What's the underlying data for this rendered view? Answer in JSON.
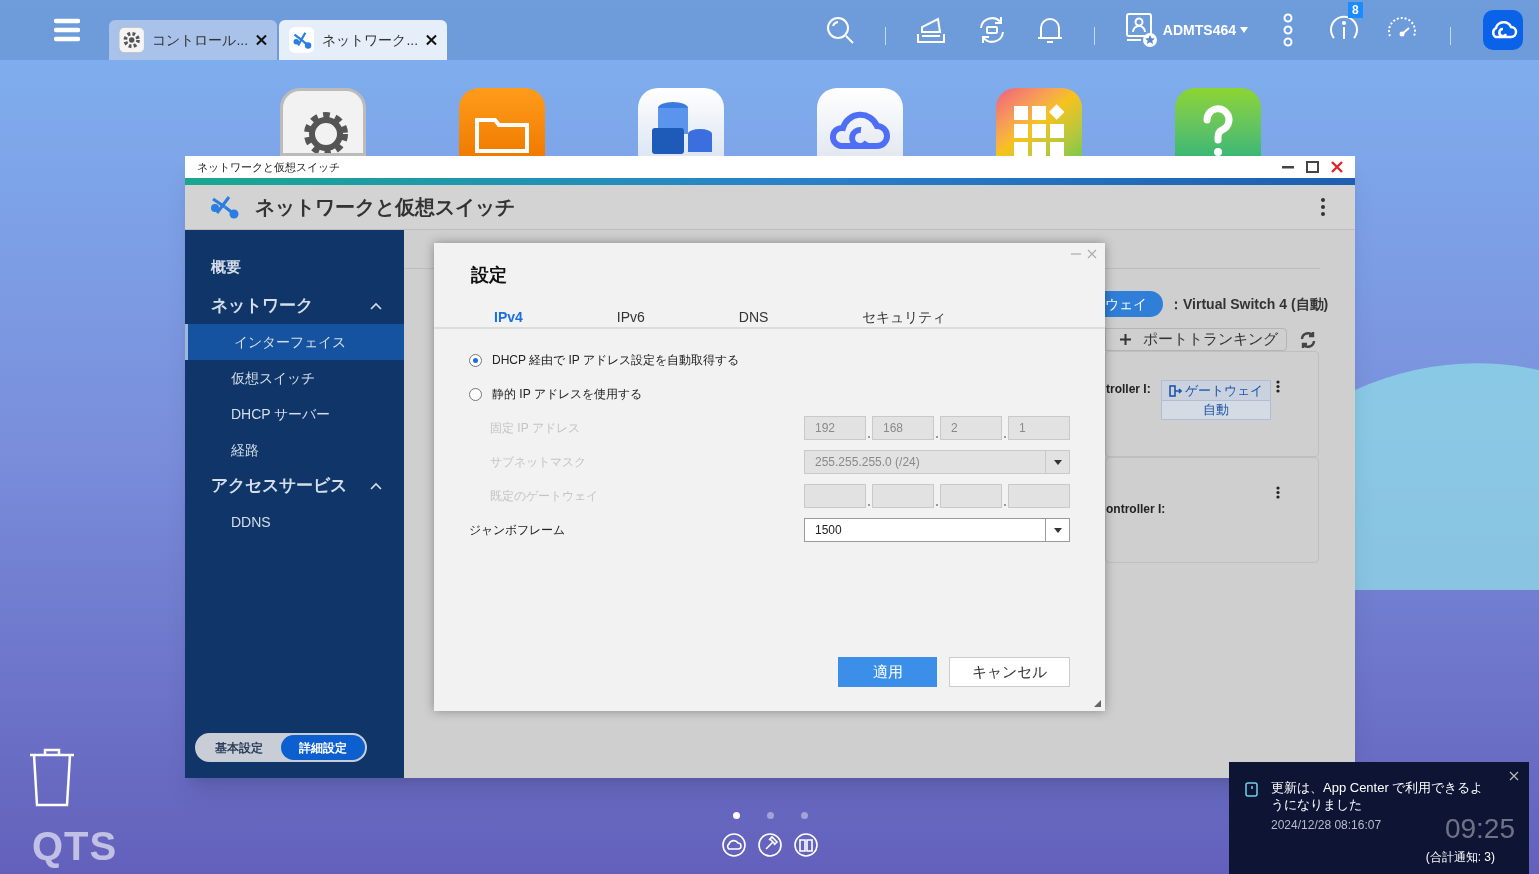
{
  "taskbar": {
    "tabs": [
      {
        "label": "コントロール...",
        "selected": false,
        "kind": "gear"
      },
      {
        "label": "ネットワーク...",
        "selected": true,
        "kind": "network"
      }
    ],
    "username": "ADMTS464",
    "info_badge": "8"
  },
  "window": {
    "title": "ネットワークと仮想スイッチ",
    "app_title": "ネットワークと仮想スイッチ"
  },
  "sidebar": {
    "items": [
      {
        "label": "概要",
        "kind": "top"
      },
      {
        "label": "ネットワーク",
        "kind": "group",
        "expanded": true,
        "children": [
          {
            "label": "インターフェイス",
            "selected": true
          },
          {
            "label": "仮想スイッチ",
            "selected": false
          },
          {
            "label": "DHCP サーバー",
            "selected": false
          },
          {
            "label": "経路",
            "selected": false
          }
        ]
      },
      {
        "label": "アクセスサービス",
        "kind": "group",
        "expanded": true,
        "children": [
          {
            "label": "DDNS",
            "selected": false
          }
        ]
      }
    ],
    "mode_toggle": [
      {
        "label": "基本設定",
        "selected": false
      },
      {
        "label": "詳細設定",
        "selected": true
      }
    ]
  },
  "background_panel": {
    "gateway_pill": "ウェイ",
    "gateway_value": "：Virtual Switch 4 (自動)",
    "port_trunking": "ポートトランキング",
    "cards": [
      {
        "label": "troller I:",
        "gateway": "ゲートウェイ",
        "gateway_mode": "自動"
      },
      {
        "label": "ontroller I:"
      }
    ]
  },
  "dialog": {
    "title": "設定",
    "tabs": [
      {
        "label": "IPv4",
        "selected": true
      },
      {
        "label": "IPv6",
        "selected": false
      },
      {
        "label": "DNS",
        "selected": false
      },
      {
        "label": "セキュリティ",
        "selected": false
      }
    ],
    "options": [
      {
        "label": "DHCP 経由で IP アドレス設定を自動取得する",
        "selected": true
      },
      {
        "label": "静的 IP アドレスを使用する",
        "selected": false
      }
    ],
    "fields": [
      {
        "label": "固定 IP アドレス",
        "kind": "ip",
        "disabled": true,
        "values": [
          "192",
          "168",
          "2",
          "1"
        ]
      },
      {
        "label": "サブネットマスク",
        "kind": "select",
        "disabled": true,
        "value": "255.255.255.0 (/24)"
      },
      {
        "label": "既定のゲートウェイ",
        "kind": "ip",
        "disabled": true
      },
      {
        "label": "ジャンボフレーム",
        "kind": "select",
        "disabled": false,
        "value": "1500"
      }
    ],
    "buttons": [
      {
        "label": "適用",
        "kind": "primary"
      },
      {
        "label": "キャンセル",
        "kind": "secondary"
      }
    ]
  },
  "notification": {
    "message": "更新は、App Center で利用できるようになりました",
    "time": "2024/12/28 08:16:07",
    "total": "(合計通知: 3)"
  },
  "clock": {
    "time": "09:25"
  },
  "desktop": {
    "pages": [
      {
        "selected": true
      },
      {
        "selected": false
      },
      {
        "selected": false
      }
    ],
    "logo": "QTS"
  }
}
